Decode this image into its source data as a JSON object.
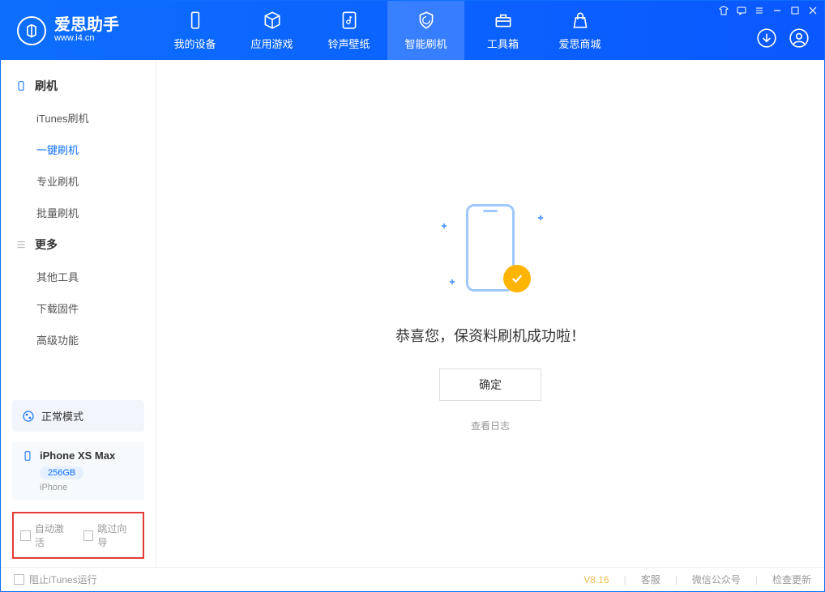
{
  "app": {
    "name": "爱思助手",
    "url": "www.i4.cn"
  },
  "nav": {
    "tabs": [
      {
        "label": "我的设备"
      },
      {
        "label": "应用游戏"
      },
      {
        "label": "铃声壁纸"
      },
      {
        "label": "智能刷机"
      },
      {
        "label": "工具箱"
      },
      {
        "label": "爱思商城"
      }
    ],
    "active_index": 3
  },
  "sidebar": {
    "section1": {
      "title": "刷机"
    },
    "items1": [
      {
        "label": "iTunes刷机"
      },
      {
        "label": "一键刷机"
      },
      {
        "label": "专业刷机"
      },
      {
        "label": "批量刷机"
      }
    ],
    "active1_index": 1,
    "section2": {
      "title": "更多"
    },
    "items2": [
      {
        "label": "其他工具"
      },
      {
        "label": "下载固件"
      },
      {
        "label": "高级功能"
      }
    ],
    "mode": {
      "label": "正常模式"
    },
    "device": {
      "name": "iPhone XS Max",
      "storage": "256GB",
      "type": "iPhone"
    },
    "checks": {
      "auto_activate": "自动激活",
      "skip_guide": "跳过向导"
    }
  },
  "main": {
    "success_text": "恭喜您，保资料刷机成功啦！",
    "ok_button": "确定",
    "view_log": "查看日志"
  },
  "footer": {
    "block_itunes": "阻止iTunes运行",
    "version": "V8.16",
    "links": {
      "service": "客服",
      "wechat": "微信公众号",
      "update": "检查更新"
    }
  },
  "colors": {
    "primary": "#0d6efd",
    "accent": "#ffb400",
    "highlight_border": "#e53935"
  }
}
